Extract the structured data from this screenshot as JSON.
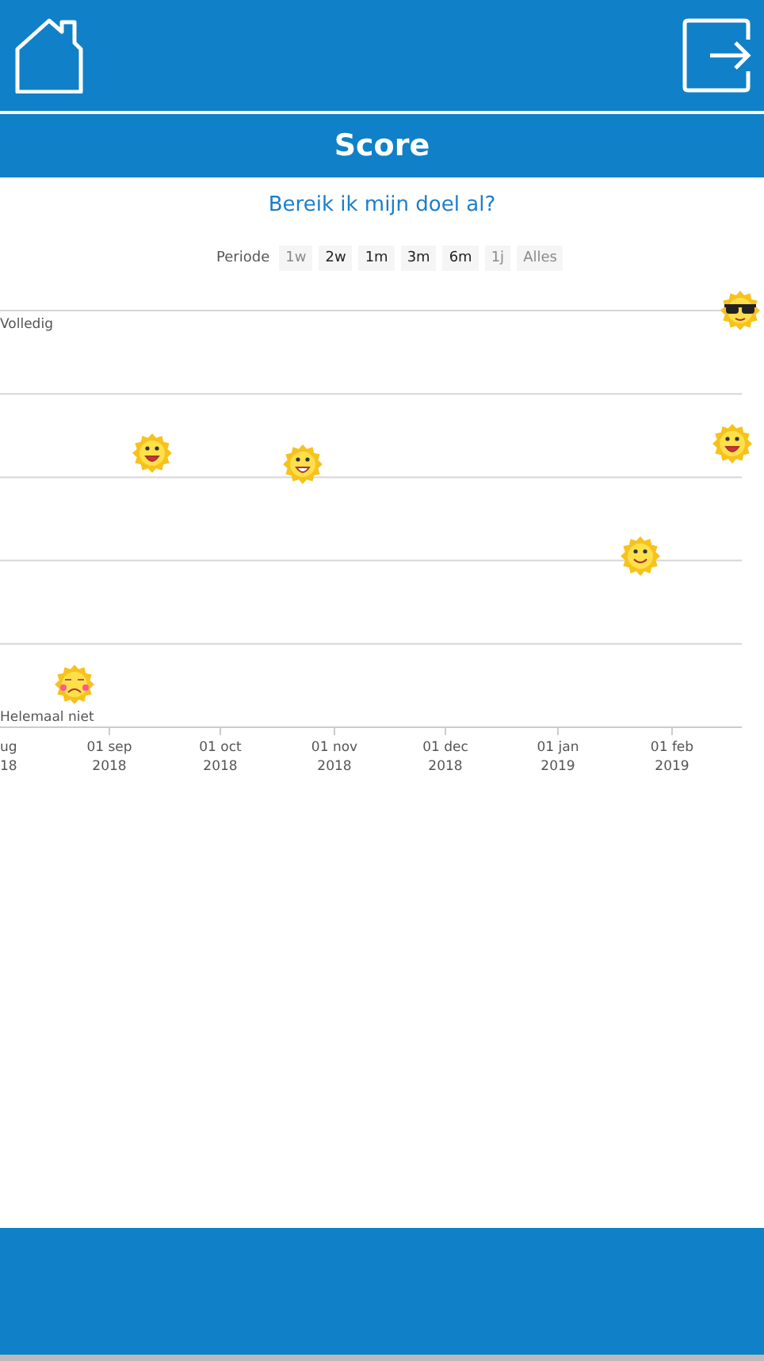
{
  "header": {
    "title": "Score"
  },
  "chart": {
    "title": "Bereik ik mijn doel al?",
    "period": {
      "label": "Periode",
      "options": [
        {
          "label": "1w",
          "disabled": true
        },
        {
          "label": "2w",
          "disabled": false
        },
        {
          "label": "1m",
          "disabled": false
        },
        {
          "label": "3m",
          "disabled": false
        },
        {
          "label": "6m",
          "disabled": false
        },
        {
          "label": "1j",
          "disabled": true
        },
        {
          "label": "Alles",
          "disabled": true
        }
      ]
    },
    "y_axis_labels": [
      "Volledig",
      "Helemaal niet"
    ],
    "x_axis_labels": [
      "ug\n18",
      "01 sep\n2018",
      "01 oct\n2018",
      "01 nov\n2018",
      "01 dec\n2018",
      "01 jan\n2019",
      "01 feb\n2019"
    ]
  }
}
